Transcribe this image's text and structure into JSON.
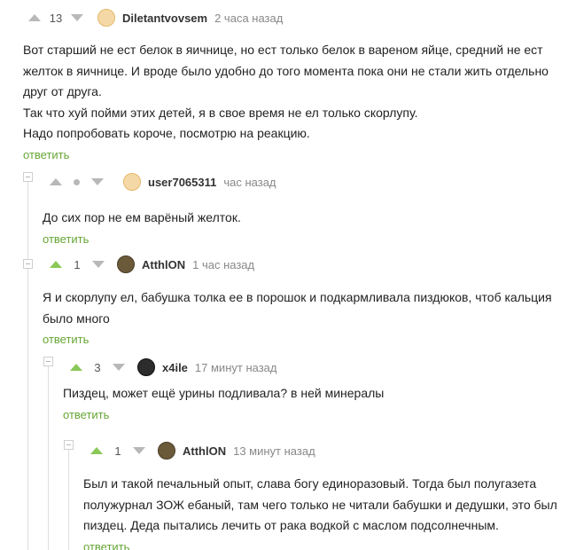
{
  "comments": [
    {
      "score": "13",
      "nick": "Diletantvovsem",
      "time": "2 часа назад",
      "lines": [
        "Вот старший не ест белок в яичнице, но ест только белок в вареном яйце, средний не ест желток в яичнице. И вроде было удобно до того момента пока они не стали жить отдельно друг от друга.",
        "Так что хуй пойми этих детей, я в свое время не ел только скорлупу.",
        "Надо попробовать короче, посмотрю на реакцию."
      ],
      "reply": "ответить"
    },
    {
      "score": "",
      "nick": "user7065311",
      "time": "час назад",
      "lines": [
        "До сих пор не ем варёный желток."
      ],
      "reply": "ответить"
    },
    {
      "score": "1",
      "nick": "AtthlON",
      "time": "1 час назад",
      "lines": [
        "Я и скорлупу ел, бабушка толка ее в порошок и подкармливала пиздюков, чтоб кальция было много"
      ],
      "reply": "ответить"
    },
    {
      "score": "3",
      "nick": "x4ile",
      "time": "17 минут назад",
      "lines": [
        "Пиздец, может ещё урины подливала? в ней минералы"
      ],
      "reply": "ответить"
    },
    {
      "score": "1",
      "nick": "AtthlON",
      "time": "13 минут назад",
      "lines": [
        "Был и такой печальный опыт, слава богу единоразовый. Тогда был полугазета полужурнал ЗОЖ ебаный, там чего только не читали бабушки и дедушки, это был пиздец. Деда пытались лечить от рака водкой с маслом подсолнечным."
      ],
      "reply": "ответить"
    }
  ],
  "colors": {
    "accent_green": "#8ac858",
    "reply_green": "#66a634",
    "arrow_gray": "#b8b8b8"
  }
}
